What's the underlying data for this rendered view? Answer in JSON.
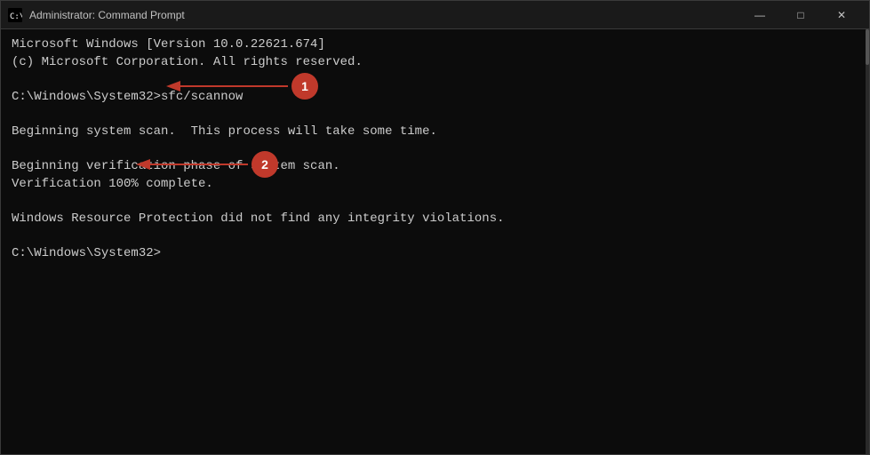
{
  "window": {
    "title": "Administrator: Command Prompt",
    "icon": "cmd"
  },
  "titlebar": {
    "minimize_label": "—",
    "maximize_label": "□",
    "close_label": "✕"
  },
  "terminal": {
    "lines": [
      "Microsoft Windows [Version 10.0.22621.674]",
      "(c) Microsoft Corporation. All rights reserved.",
      "",
      "C:\\Windows\\System32>sfc/scannow",
      "",
      "Beginning system scan.  This process will take some time.",
      "",
      "Beginning verification phase of system scan.",
      "Verification 100% complete.",
      "",
      "Windows Resource Protection did not find any integrity violations.",
      "",
      "C:\\Windows\\System32>"
    ]
  },
  "annotations": {
    "badge1": "1",
    "badge2": "2"
  }
}
